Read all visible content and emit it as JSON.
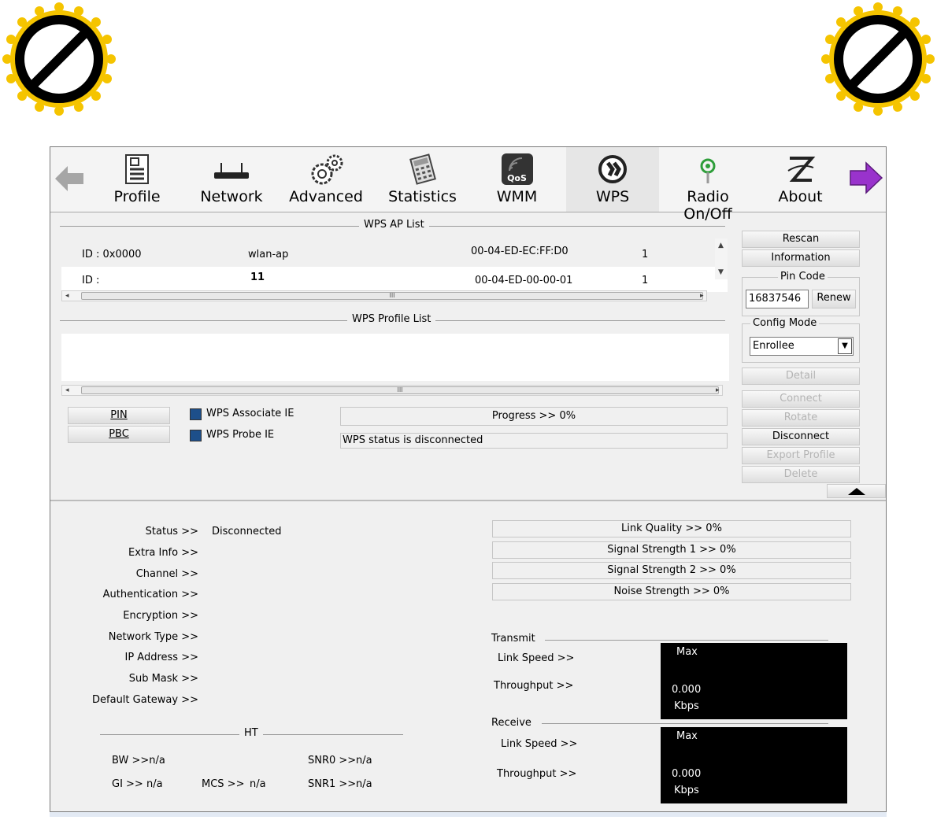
{
  "toolbar": {
    "items": [
      {
        "label": "Profile",
        "icon": "profile-icon"
      },
      {
        "label": "Network",
        "icon": "network-router-icon"
      },
      {
        "label": "Advanced",
        "icon": "advanced-gears-icon"
      },
      {
        "label": "Statistics",
        "icon": "statistics-calculator-icon"
      },
      {
        "label": "WMM",
        "icon": "qos-icon",
        "icon_text": "QoS"
      },
      {
        "label": "WPS",
        "icon": "wps-icon",
        "selected": true
      },
      {
        "label": "Radio On/Off",
        "icon": "radio-antenna-icon"
      },
      {
        "label": "About",
        "icon": "about-logo-icon"
      }
    ]
  },
  "wps_ap_list": {
    "title": "WPS AP List",
    "rows": [
      {
        "id": "ID : 0x0000",
        "ssid": "wlan-ap",
        "mac": "00-04-ED-EC:FF:D0",
        "channel": "1"
      },
      {
        "id": "ID :",
        "ssid": "11",
        "mac": "00-04-ED-00-00-01",
        "channel": "1"
      }
    ],
    "scroll_grip": "III"
  },
  "wps_profile_list": {
    "title": "WPS Profile List",
    "scroll_grip": "III"
  },
  "right_panel": {
    "rescan": "Rescan",
    "information": "Information",
    "pin_code_label": "Pin Code",
    "pin_code_value": "16837546",
    "renew": "Renew",
    "config_mode_label": "Config Mode",
    "config_mode_value": "Enrollee",
    "detail": "Detail",
    "connect": "Connect",
    "rotate": "Rotate",
    "disconnect": "Disconnect",
    "export_profile": "Export Profile",
    "delete": "Delete"
  },
  "actions": {
    "pin": "PIN",
    "pbc": "PBC",
    "wps_associate_ie": "WPS Associate IE",
    "wps_probe_ie": "WPS Probe IE",
    "progress": "Progress >> 0%",
    "status_text": "WPS status is disconnected"
  },
  "status": {
    "labels": [
      "Status >>",
      "Extra Info >>",
      "Channel >>",
      "Authentication >>",
      "Encryption >>",
      "Network Type >>",
      "IP Address >>",
      "Sub Mask >>",
      "Default Gateway >>"
    ],
    "status_value": "Disconnected"
  },
  "ht": {
    "title": "HT",
    "bw": "BW >>n/a",
    "gi": "GI >> n/a",
    "mcs_label": "MCS >>",
    "mcs_value": "n/a",
    "snr0_label": "SNR0 >>",
    "snr0_value": "n/a",
    "snr1_label": "SNR1 >>",
    "snr1_value": "n/a"
  },
  "quality": {
    "link_quality": "Link Quality >> 0%",
    "signal1": "Signal Strength 1 >> 0%",
    "signal2": "Signal Strength 2 >> 0%",
    "noise": "Noise Strength >> 0%"
  },
  "transmit": {
    "title": "Transmit",
    "link_speed": "Link Speed >>",
    "throughput": "Throughput >>",
    "max": "Max",
    "value": "0.000",
    "unit": "Kbps"
  },
  "receive": {
    "title": "Receive",
    "link_speed": "Link Speed >>",
    "throughput": "Throughput >>",
    "max": "Max",
    "value": "0.000",
    "unit": "Kbps"
  },
  "colors": {
    "badge_yellow": "#f5c400",
    "nav_forward_purple": "#9933cc",
    "nav_back_gray": "#a6a6a6"
  }
}
